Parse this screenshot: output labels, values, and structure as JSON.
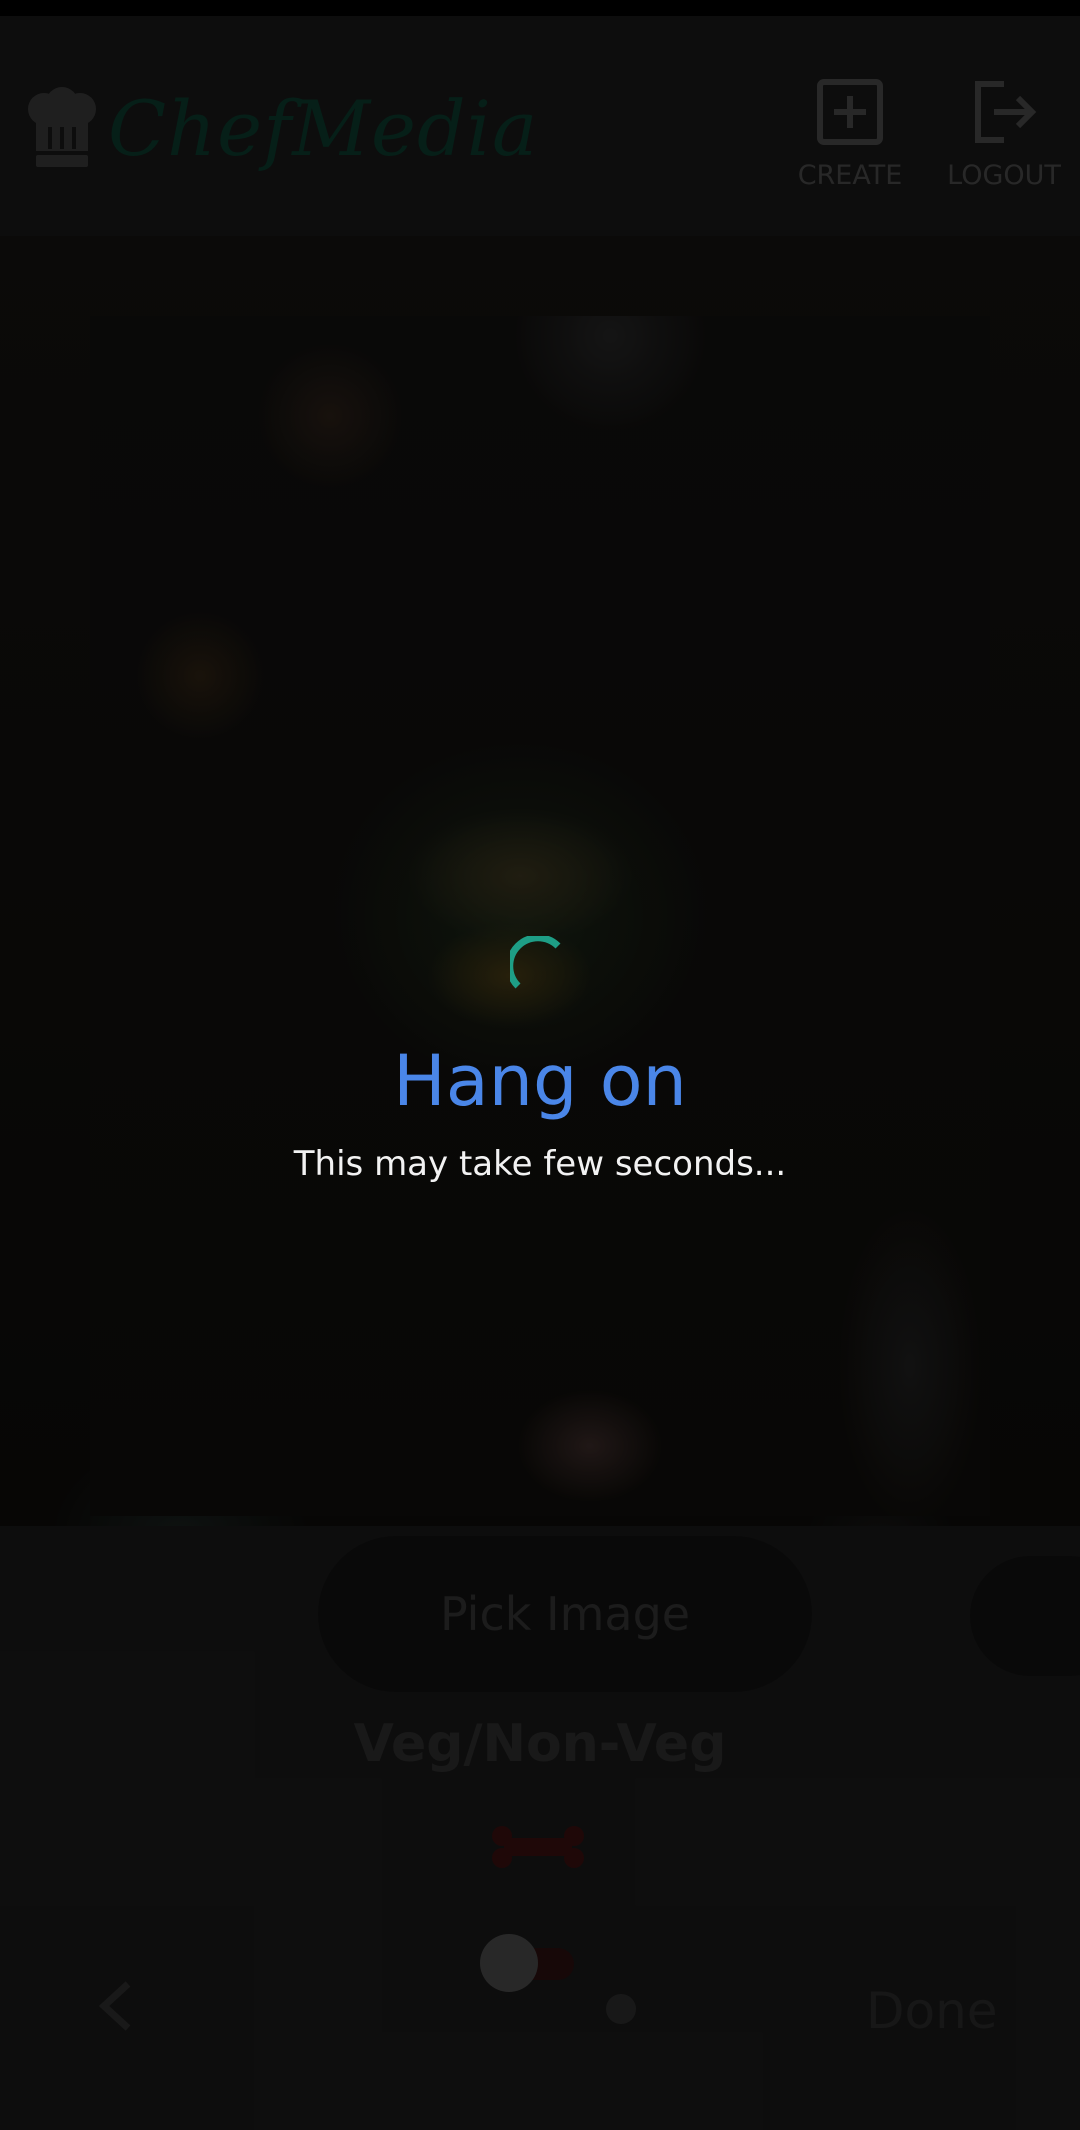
{
  "header": {
    "brand_name": "ChefMedia",
    "create_label": "CREATE",
    "logout_label": "LOGOUT"
  },
  "form": {
    "pick_image_label": "Pick Image",
    "veg_label": "Veg/Non-Veg",
    "veg_toggle_on": false
  },
  "nav": {
    "done_label": "Done"
  },
  "loading": {
    "title": "Hang on",
    "subtitle": "This may take few seconds..."
  },
  "colors": {
    "accent_blue": "#4a86e8",
    "spinner_teal": "#1e9e86",
    "brand_green": "#0b3a2c"
  }
}
